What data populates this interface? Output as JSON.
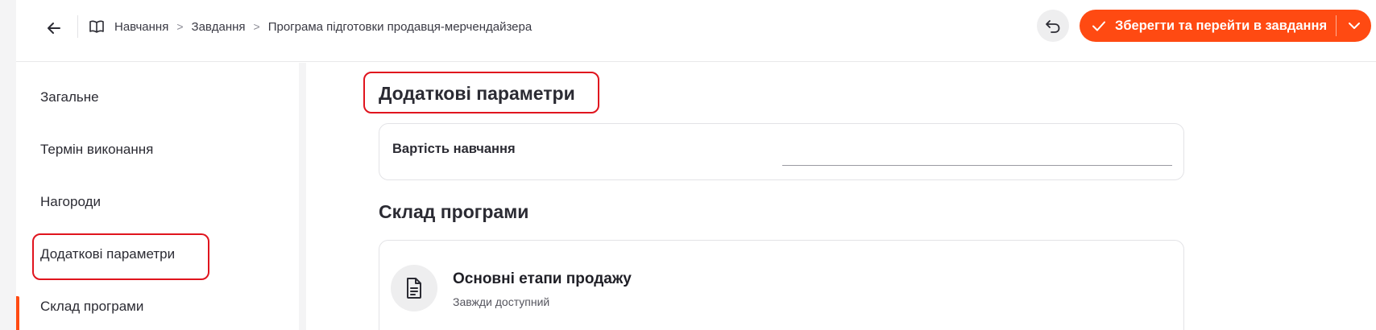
{
  "header": {
    "breadcrumbs": [
      "Навчання",
      "Завдання",
      "Програма підготовки продавця-мерчендайзера"
    ],
    "primary_button_label": "Зберегти та перейти в завдання"
  },
  "sidebar": {
    "items": [
      {
        "label": "Загальне"
      },
      {
        "label": "Термін виконання"
      },
      {
        "label": "Нагороди"
      },
      {
        "label": "Додаткові параметри",
        "active": true
      },
      {
        "label": "Склад програми"
      }
    ]
  },
  "main": {
    "additional_params": {
      "title": "Додаткові параметри",
      "cost_label": "Вартість навчання",
      "cost_value": ""
    },
    "program": {
      "title": "Склад програми",
      "stages": [
        {
          "title": "Основні етапи продажу",
          "subtitle": "Завжди доступний"
        }
      ]
    }
  },
  "colors": {
    "accent": "#ff4a12",
    "highlight_border": "#e0141e",
    "sidebar_bg": "#f4f4f5"
  },
  "icons": [
    "arrow-left-icon",
    "book-icon",
    "chevron-right-icon",
    "undo-icon",
    "check-icon",
    "chevron-down-icon",
    "document-icon"
  ]
}
